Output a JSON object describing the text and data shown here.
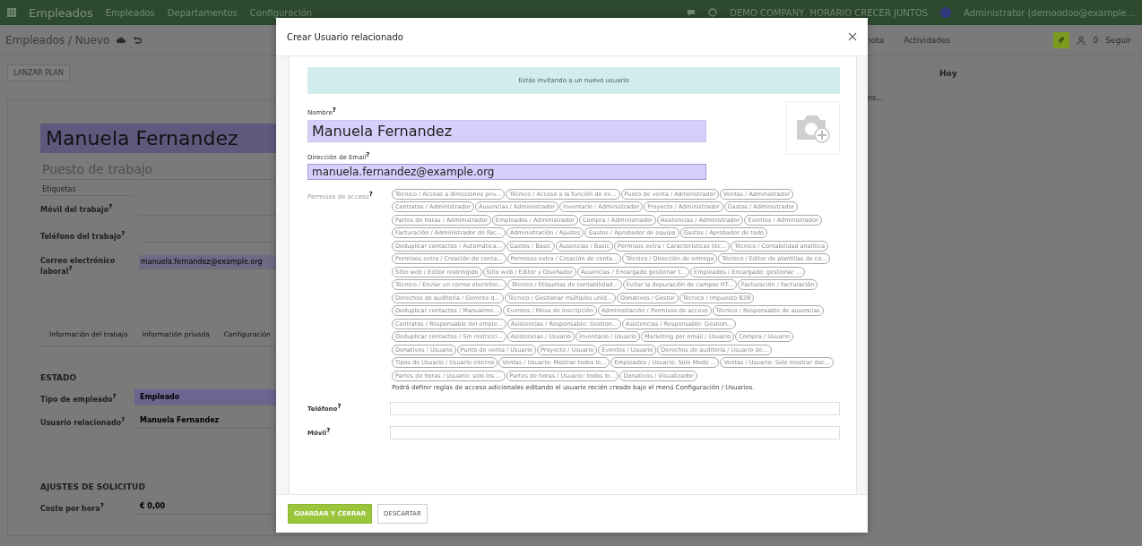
{
  "top_bar": {
    "app_name": "Empleados",
    "menu": [
      "Empleados",
      "Departamentos",
      "Configuración"
    ],
    "company": "DEMO COMPANY, HORARIO CRECER JUNTOS",
    "user": "Administrator (demoodoo@example..."
  },
  "control_panel": {
    "breadcrumb": "Empleados / Nuevo",
    "chatter_actions": [
      "nota",
      "Actividades"
    ],
    "followers": "0",
    "follow": "Seguir"
  },
  "header_button": "LANZAR PLAN",
  "employee_form": {
    "name": "Manuela Fernandez",
    "job_title_placeholder": "Puesto de trabajo",
    "tags_placeholder": "Etiquetas",
    "fields": [
      {
        "label": "Móvil del trabajo$^{?}$"
      },
      {
        "label": "Teléfono del trabajo$^{?}$"
      },
      {
        "label": "Correo electrónico laboral$^{?}$",
        "value": "manuela.fernandez@example.org"
      }
    ],
    "tabs": [
      {
        "label": "Información del trabajo",
        "selected": false
      },
      {
        "label": "Información privada",
        "selected": false
      },
      {
        "label": "Configuración",
        "selected": false
      }
    ],
    "sections": [
      {
        "title": "ESTADO",
        "fields": [
          {
            "label": "Tipo de empleado$^{?}$",
            "value": "Empleado",
            "required": true
          },
          {
            "label": "Usuario relacionado$^{?}$",
            "value": "Manuela Fernandez",
            "required": false
          }
        ]
      },
      {
        "title": "AJUSTES DE SOLICITUD",
        "fields": [
          {
            "label": "Coste por hora$^{?}$",
            "value": "€ 0,00",
            "required": false
          }
        ]
      }
    ]
  },
  "chatter": {
    "date_label": "Hoy",
    "snippet": "ns..."
  },
  "dialog": {
    "title": "Crear Usuario relacionado",
    "alert": "Estás invitando a un nuevo usuario",
    "name": {
      "label": "Nombre$^{?}$",
      "value": "Manuela Fernandez"
    },
    "email": {
      "label": "Dirección de Email$^{?}$",
      "value": "manuela.fernandez@example.org"
    },
    "permissions": {
      "label": "Permisos de acceso$^{?}$",
      "tags": [
        "Técnico / Acceso a direcciones priv...",
        "Técnico / Acceso a la función de ex...",
        "Punto de venta / Administrador",
        "Ventas / Administrador",
        "Contratos / Administrador",
        "Ausencias / Administrador",
        "Inventario / Administrador",
        "Proyecto / Administrador",
        "Gastos / Administrador",
        "Partes de horas / Administrador",
        "Empleados / Administrador",
        "Compra / Administrador",
        "Asistencias / Administrador",
        "Eventos / Administrador",
        "Facturación / Administrador de Fac...",
        "Administración / Ajustes",
        "Gastos / Aprobador de equipo",
        "Gastos / Aprobador de todo",
        "Deduplicar contactos / Automática...",
        "Gastos / Basic",
        "Ausencias / Basic",
        "Permisos extra / Características téc...",
        "Técnico / Contabilidad analítica",
        "Permisos extra / Creación de conta...",
        "Permisos extra / Creación de conta...",
        "Técnico / Dirección de entrega",
        "Técnico / Editor de plantillas de co...",
        "Sitio web / Editor restringido",
        "Sitio web / Editor y Diseñador",
        "Ausencias / Encargado gestionar t...",
        "Empleados / Encargado: gestionar ...",
        "Técnico / Enviar un correo electróni...",
        "Técnico / Etiquetas de contabilidad...",
        "Evitar la depuración de campos HT...",
        "Facturación / Facturación",
        "Derechos de auditoría / Gerente d...",
        "Técnico / Gestionar múltiples unid...",
        "Donativos / Gestor",
        "Técnico / Impuesto B2B",
        "Deduplicar contactos / Manualme...",
        "Eventos / Mesa de inscripción",
        "Administración / Permisos de acceso",
        "Técnico / Responsable de ausencias",
        "Contratos / Responsable del emple...",
        "Asistencias / Responsable: Gestion...",
        "Asistencias / Responsable: Gestion...",
        "Deduplicar contactos / Sin restricci...",
        "Asistencias / Usuario",
        "Inventario / Usuario",
        "Marketing por email / Usuario",
        "Compra / Usuario",
        "Donativos / Usuario",
        "Punto de venta / Usuario",
        "Proyecto / Usuario",
        "Eventos / Usuario",
        "Derechos de auditoría / Usuario de...",
        "Tipos de Usuario / Usuario interno",
        "Ventas / Usuario: Mostrar todos lo...",
        "Empleados / Usuario: Solo Modo ...",
        "Ventas / Usuario: Solo mostrar doc...",
        "Partes de horas / Usuario: solo los ...",
        "Partes de horas / Usuario: todos lo...",
        "Donativos / Visualizador"
      ],
      "note": "Podrá definir reglas de acceso adicionales editando el usuario recién creado bajo el menú Configuración / Usuarios."
    },
    "phone": {
      "label": "Teléfono$^{?}$"
    },
    "mobile": {
      "label": "Móvil$^{?}$"
    },
    "buttons": [
      {
        "label": "GUARDAR Y CERRAR",
        "kind": "primary"
      },
      {
        "label": "DESCARTAR",
        "kind": "secondary"
      }
    ]
  }
}
